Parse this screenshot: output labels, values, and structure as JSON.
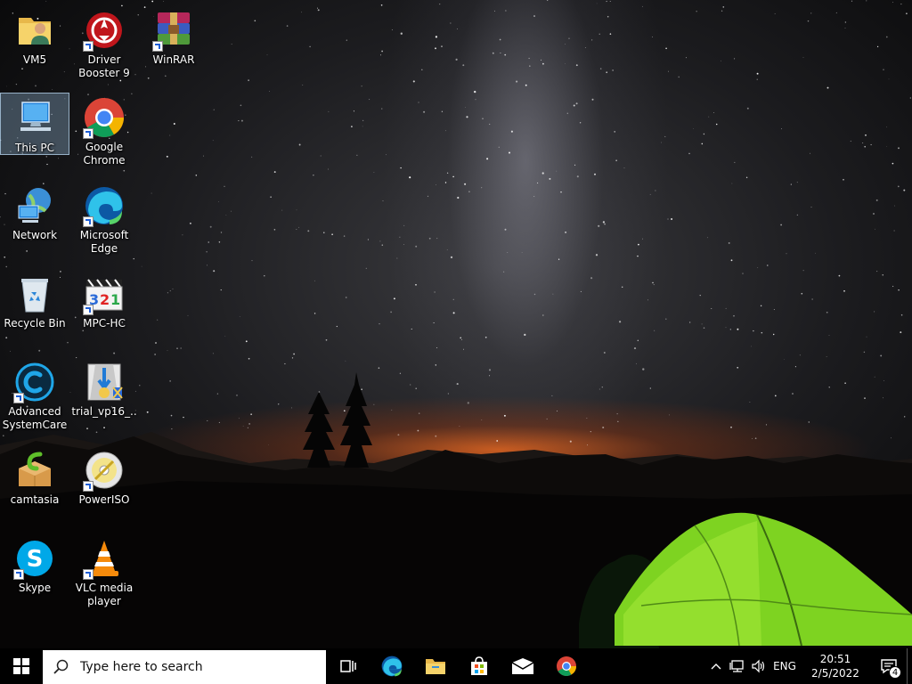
{
  "desktop": {
    "icons": [
      {
        "label": "VM5",
        "icon": "user-folder-icon",
        "shortcut": false
      },
      {
        "label": "Driver Booster 9",
        "icon": "driver-booster-icon",
        "shortcut": true
      },
      {
        "label": "WinRAR",
        "icon": "winrar-icon",
        "shortcut": true
      },
      {
        "label": "This PC",
        "icon": "this-pc-icon",
        "shortcut": false,
        "selected": true
      },
      {
        "label": "Google Chrome",
        "icon": "chrome-icon",
        "shortcut": true
      },
      {
        "label": "Network",
        "icon": "network-icon",
        "shortcut": false
      },
      {
        "label": "Microsoft Edge",
        "icon": "edge-icon",
        "shortcut": true
      },
      {
        "label": "Recycle Bin",
        "icon": "recycle-bin-icon",
        "shortcut": false
      },
      {
        "label": "MPC-HC",
        "icon": "mpc-hc-icon",
        "shortcut": true
      },
      {
        "label": "Advanced SystemCare",
        "icon": "advanced-systemcare-icon",
        "shortcut": true
      },
      {
        "label": "trial_vp16_...",
        "icon": "installer-icon",
        "shortcut": false
      },
      {
        "label": "camtasia",
        "icon": "camtasia-icon",
        "shortcut": false
      },
      {
        "label": "PowerISO",
        "icon": "poweriso-icon",
        "shortcut": true
      },
      {
        "label": "Skype",
        "icon": "skype-icon",
        "shortcut": true
      },
      {
        "label": "VLC media player",
        "icon": "vlc-icon",
        "shortcut": true
      }
    ]
  },
  "taskbar": {
    "search_placeholder": "Type here to search",
    "pinned": [
      "task-view-icon",
      "edge-icon",
      "file-explorer-icon",
      "store-icon",
      "mail-icon",
      "chrome-icon"
    ],
    "tray": {
      "language": "ENG",
      "time": "20:51",
      "date": "2/5/2022",
      "notification_count": "4"
    }
  },
  "colors": {
    "taskbar_bg": "#000000",
    "selection": "#99bedc",
    "tent_green": "#7ed321"
  }
}
